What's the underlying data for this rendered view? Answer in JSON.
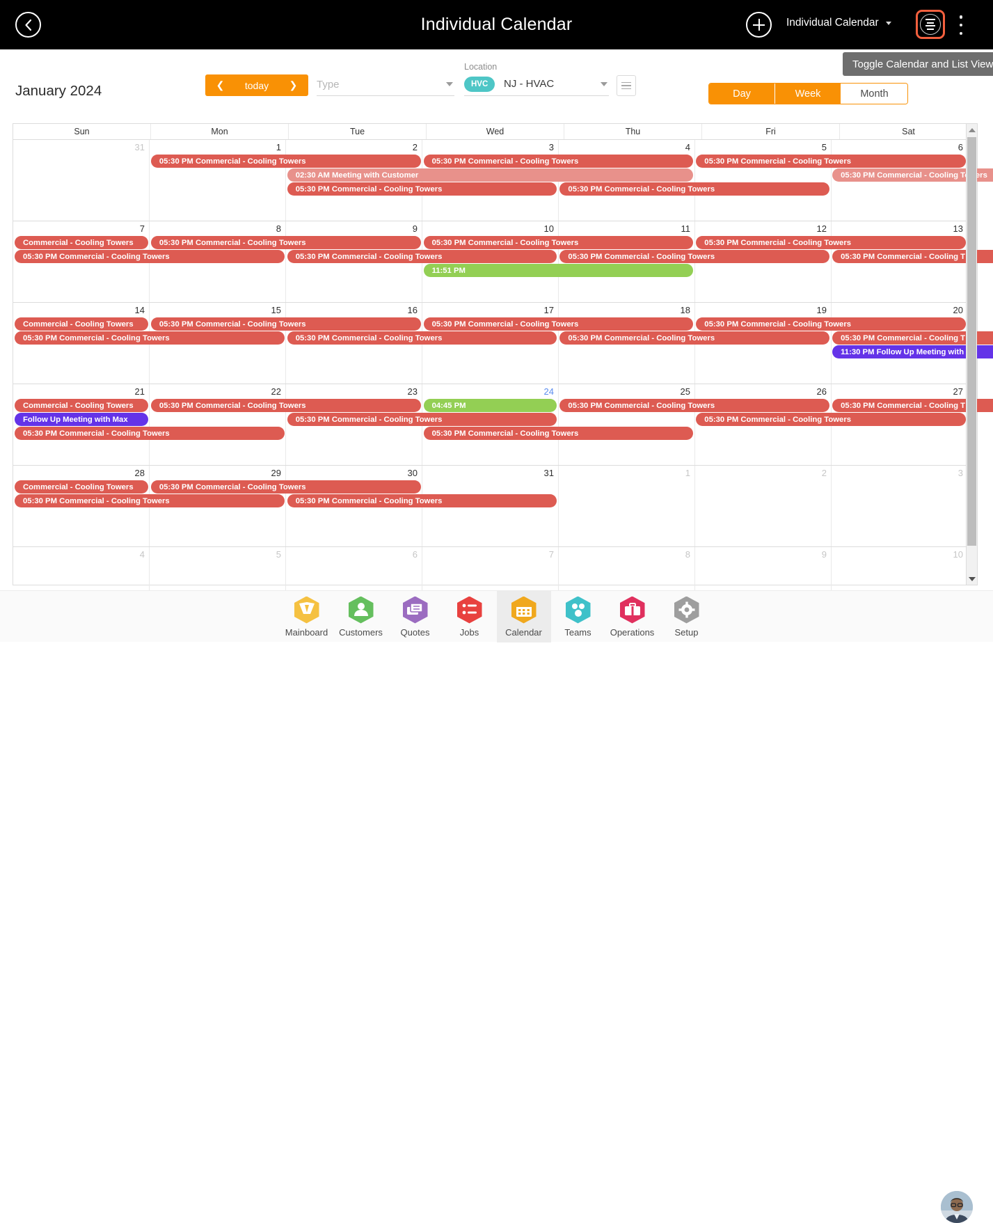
{
  "topbar": {
    "title": "Individual Calendar",
    "back_icon": "chevron-left-icon",
    "add_icon": "plus-icon",
    "calendar_selector_label": "Individual Calendar",
    "list_toggle_icon": "list-view-icon",
    "kebab_icon": "more-vertical-icon"
  },
  "tooltip": {
    "text": "Toggle Calendar and List View"
  },
  "controls": {
    "month_label": "January 2024",
    "prev_label": "❮",
    "today_label": "today",
    "next_label": "❯",
    "type_placeholder": "Type",
    "type_value": "",
    "location_label": "Location",
    "location_chip": "HVC",
    "location_value": "NJ - HVAC",
    "list_icon": "list-icon"
  },
  "view_toggle": {
    "options": [
      {
        "label": "Day",
        "selected": true
      },
      {
        "label": "Week",
        "selected": true
      },
      {
        "label": "Month",
        "selected": false
      }
    ]
  },
  "calendar": {
    "daynames": [
      "Sun",
      "Mon",
      "Tue",
      "Wed",
      "Thu",
      "Fri",
      "Sat"
    ],
    "weeks": [
      {
        "days": [
          {
            "num": "31",
            "muted": true
          },
          {
            "num": "1"
          },
          {
            "num": "2"
          },
          {
            "num": "3"
          },
          {
            "num": "4"
          },
          {
            "num": "5"
          },
          {
            "num": "6"
          }
        ],
        "events": [
          {
            "label": "05:30 PM Commercial - Cooling Towers",
            "color": "red",
            "start": 1,
            "span": 2,
            "row": 0
          },
          {
            "label": "05:30 PM Commercial - Cooling Towers",
            "color": "red",
            "start": 3,
            "span": 2,
            "row": 0
          },
          {
            "label": "05:30 PM Commercial - Cooling Towers",
            "color": "red",
            "start": 5,
            "span": 2,
            "row": 0
          },
          {
            "label": "02:30 AM Meeting with Customer",
            "color": "redl",
            "start": 2,
            "span": 3,
            "row": 1
          },
          {
            "label": "05:30 PM Commercial - Cooling Towers",
            "color": "redl",
            "start": 6,
            "span": 2,
            "row": 1
          },
          {
            "label": "05:30 PM Commercial - Cooling Towers",
            "color": "red",
            "start": 2,
            "span": 2,
            "row": 2
          },
          {
            "label": "05:30 PM Commercial - Cooling Towers",
            "color": "red",
            "start": 4,
            "span": 2,
            "row": 2
          }
        ]
      },
      {
        "days": [
          {
            "num": "7"
          },
          {
            "num": "8"
          },
          {
            "num": "9"
          },
          {
            "num": "10"
          },
          {
            "num": "11"
          },
          {
            "num": "12"
          },
          {
            "num": "13"
          }
        ],
        "events": [
          {
            "label": "Commercial - Cooling Towers",
            "color": "red",
            "start": 0,
            "span": 1,
            "row": 0
          },
          {
            "label": "05:30 PM Commercial - Cooling Towers",
            "color": "red",
            "start": 1,
            "span": 2,
            "row": 0
          },
          {
            "label": "05:30 PM Commercial - Cooling Towers",
            "color": "red",
            "start": 3,
            "span": 2,
            "row": 0
          },
          {
            "label": "05:30 PM Commercial - Cooling Towers",
            "color": "red",
            "start": 5,
            "span": 2,
            "row": 0
          },
          {
            "label": "05:30 PM Commercial - Cooling Towers",
            "color": "red",
            "start": 0,
            "span": 2,
            "row": 1
          },
          {
            "label": "05:30 PM Commercial - Cooling Towers",
            "color": "red",
            "start": 2,
            "span": 2,
            "row": 1
          },
          {
            "label": "05:30 PM Commercial - Cooling Towers",
            "color": "red",
            "start": 4,
            "span": 2,
            "row": 1
          },
          {
            "label": "05:30 PM Commercial - Cooling T",
            "color": "red",
            "start": 6,
            "span": 2,
            "row": 1
          },
          {
            "label": "11:51 PM",
            "color": "green",
            "start": 3,
            "span": 2,
            "row": 2
          }
        ]
      },
      {
        "days": [
          {
            "num": "14"
          },
          {
            "num": "15"
          },
          {
            "num": "16"
          },
          {
            "num": "17"
          },
          {
            "num": "18"
          },
          {
            "num": "19"
          },
          {
            "num": "20"
          }
        ],
        "events": [
          {
            "label": "Commercial - Cooling Towers",
            "color": "red",
            "start": 0,
            "span": 1,
            "row": 0
          },
          {
            "label": "05:30 PM Commercial - Cooling Towers",
            "color": "red",
            "start": 1,
            "span": 2,
            "row": 0
          },
          {
            "label": "05:30 PM Commercial - Cooling Towers",
            "color": "red",
            "start": 3,
            "span": 2,
            "row": 0
          },
          {
            "label": "05:30 PM Commercial - Cooling Towers",
            "color": "red",
            "start": 5,
            "span": 2,
            "row": 0
          },
          {
            "label": "05:30 PM Commercial - Cooling Towers",
            "color": "red",
            "start": 0,
            "span": 2,
            "row": 1
          },
          {
            "label": "05:30 PM Commercial - Cooling Towers",
            "color": "red",
            "start": 2,
            "span": 2,
            "row": 1
          },
          {
            "label": "05:30 PM Commercial - Cooling Towers",
            "color": "red",
            "start": 4,
            "span": 2,
            "row": 1
          },
          {
            "label": "05:30 PM Commercial - Cooling T",
            "color": "red",
            "start": 6,
            "span": 2,
            "row": 1
          },
          {
            "label": "11:30 PM Follow Up Meeting with",
            "color": "purp",
            "start": 6,
            "span": 2,
            "row": 2
          }
        ]
      },
      {
        "days": [
          {
            "num": "21"
          },
          {
            "num": "22"
          },
          {
            "num": "23"
          },
          {
            "num": "24",
            "today": true
          },
          {
            "num": "25"
          },
          {
            "num": "26"
          },
          {
            "num": "27"
          }
        ],
        "events": [
          {
            "label": "Commercial - Cooling Towers",
            "color": "red",
            "start": 0,
            "span": 1,
            "row": 0
          },
          {
            "label": "05:30 PM Commercial - Cooling Towers",
            "color": "red",
            "start": 1,
            "span": 2,
            "row": 0
          },
          {
            "label": "04:45 PM",
            "color": "green",
            "start": 3,
            "span": 1,
            "row": 0
          },
          {
            "label": "05:30 PM Commercial - Cooling Towers",
            "color": "red",
            "start": 4,
            "span": 2,
            "row": 0
          },
          {
            "label": "05:30 PM Commercial - Cooling T",
            "color": "red",
            "start": 6,
            "span": 2,
            "row": 0
          },
          {
            "label": "Follow Up Meeting with Max",
            "color": "purp",
            "start": 0,
            "span": 1,
            "row": 1
          },
          {
            "label": "05:30 PM Commercial - Cooling Towers",
            "color": "red",
            "start": 2,
            "span": 2,
            "row": 1
          },
          {
            "label": "05:30 PM Commercial - Cooling Towers",
            "color": "red",
            "start": 5,
            "span": 2,
            "row": 1
          },
          {
            "label": "05:30 PM Commercial - Cooling Towers",
            "color": "red",
            "start": 0,
            "span": 2,
            "row": 2
          },
          {
            "label": "05:30 PM Commercial - Cooling Towers",
            "color": "red",
            "start": 3,
            "span": 2,
            "row": 2
          }
        ]
      },
      {
        "days": [
          {
            "num": "28"
          },
          {
            "num": "29"
          },
          {
            "num": "30"
          },
          {
            "num": "31"
          },
          {
            "num": "1",
            "muted": true
          },
          {
            "num": "2",
            "muted": true
          },
          {
            "num": "3",
            "muted": true
          }
        ],
        "events": [
          {
            "label": "Commercial - Cooling Towers",
            "color": "red",
            "start": 0,
            "span": 1,
            "row": 0
          },
          {
            "label": "05:30 PM Commercial - Cooling Towers",
            "color": "red",
            "start": 1,
            "span": 2,
            "row": 0
          },
          {
            "label": "05:30 PM Commercial - Cooling Towers",
            "color": "red",
            "start": 0,
            "span": 2,
            "row": 1
          },
          {
            "label": "05:30 PM Commercial - Cooling Towers",
            "color": "red",
            "start": 2,
            "span": 2,
            "row": 1
          }
        ]
      },
      {
        "days": [
          {
            "num": "4",
            "muted": true
          },
          {
            "num": "5",
            "muted": true
          },
          {
            "num": "6",
            "muted": true
          },
          {
            "num": "7",
            "muted": true
          },
          {
            "num": "8",
            "muted": true
          },
          {
            "num": "9",
            "muted": true
          },
          {
            "num": "10",
            "muted": true
          }
        ],
        "events": []
      }
    ]
  },
  "bottomnav": {
    "items": [
      {
        "label": "Mainboard",
        "icon": "mainboard-icon",
        "color": "#f5c141",
        "active": false
      },
      {
        "label": "Customers",
        "icon": "customers-icon",
        "color": "#65bf5e",
        "active": false
      },
      {
        "label": "Quotes",
        "icon": "quotes-icon",
        "color": "#9b6cc0",
        "active": false
      },
      {
        "label": "Jobs",
        "icon": "jobs-icon",
        "color": "#e8413f",
        "active": false
      },
      {
        "label": "Calendar",
        "icon": "calendar-icon",
        "color": "#f0a81e",
        "active": true
      },
      {
        "label": "Teams",
        "icon": "teams-icon",
        "color": "#3fc1c9",
        "active": false
      },
      {
        "label": "Operations",
        "icon": "operations-icon",
        "color": "#e0305e",
        "active": false
      },
      {
        "label": "Setup",
        "icon": "setup-icon",
        "color": "#9e9e9e",
        "active": false
      }
    ],
    "avatar_icon": "user-avatar"
  }
}
